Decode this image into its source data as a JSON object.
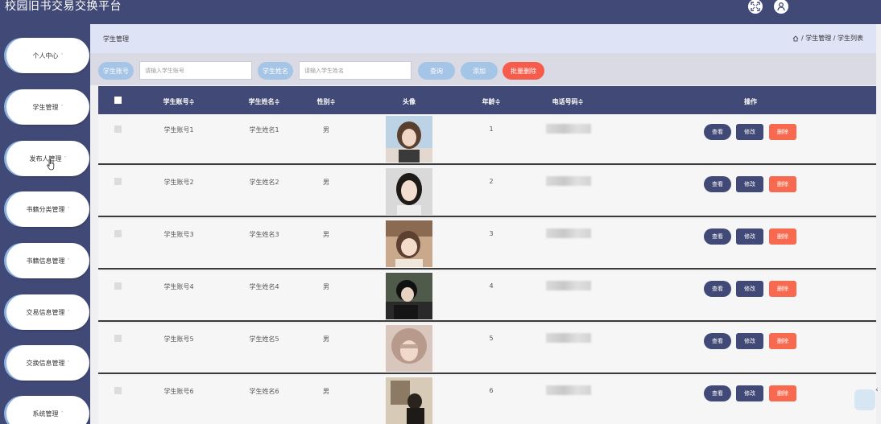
{
  "app": {
    "title": "校园旧书交易交换平台"
  },
  "sidebar": {
    "items": [
      {
        "label": "个人中心"
      },
      {
        "label": "学生管理"
      },
      {
        "label": "发布人管理"
      },
      {
        "label": "书籍分类管理"
      },
      {
        "label": "书籍信息管理"
      },
      {
        "label": "交易信息管理"
      },
      {
        "label": "交换信息管理"
      },
      {
        "label": "系统管理"
      }
    ],
    "caret": "˅"
  },
  "breadcrumb": {
    "title": "学生管理",
    "path": "/ 学生管理 / 学生列表"
  },
  "search": {
    "account_label": "学生账号",
    "account_placeholder": "请输入学生账号",
    "name_label": "学生姓名",
    "name_placeholder": "请输入学生姓名",
    "query_button": "查询",
    "add_button": "添加",
    "batch_delete_button": "批量删除"
  },
  "table": {
    "headers": {
      "account": "学生账号≑",
      "name": "学生姓名≑",
      "gender": "性别≑",
      "avatar": "头像",
      "age": "年龄≑",
      "phone": "电话号码≑",
      "actions": "操作"
    },
    "rows": [
      {
        "account": "学生账号1",
        "name": "学生姓名1",
        "gender": "男",
        "age": "1"
      },
      {
        "account": "学生账号2",
        "name": "学生姓名2",
        "gender": "男",
        "age": "2"
      },
      {
        "account": "学生账号3",
        "name": "学生姓名3",
        "gender": "男",
        "age": "3"
      },
      {
        "account": "学生账号4",
        "name": "学生姓名4",
        "gender": "男",
        "age": "4"
      },
      {
        "account": "学生账号5",
        "name": "学生姓名5",
        "gender": "男",
        "age": "5"
      },
      {
        "account": "学生账号6",
        "name": "学生姓名6",
        "gender": "男",
        "age": "6"
      }
    ],
    "actions": {
      "view": "查看",
      "edit": "修改",
      "delete": "删除"
    }
  },
  "colors": {
    "primary": "#414976",
    "accent_light": "#a5c5e6",
    "danger": "#f65c4b"
  },
  "icons": {
    "fullscreen": "fullscreen-icon",
    "user": "user-icon",
    "home": "home-icon",
    "cursor": "hand-cursor-icon"
  }
}
